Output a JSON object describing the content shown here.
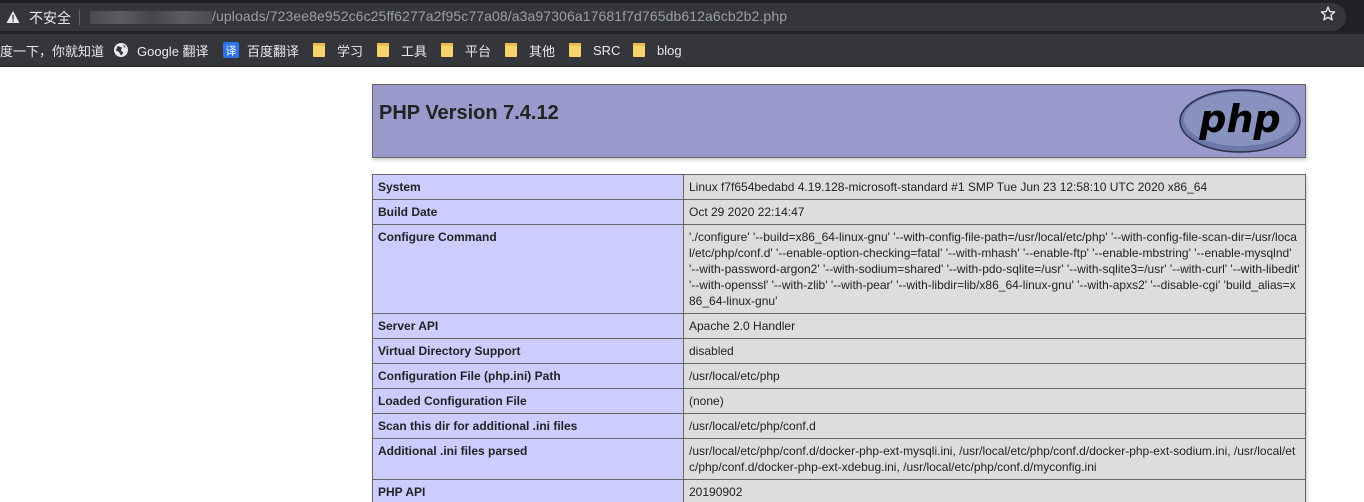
{
  "browser": {
    "security_label": "不安全",
    "url_visible": "/uploads/723ee8e952c6c25ff6277a2f95c77a08/a3a97306a17681f7d765db612a6cb2b2.php",
    "bookmarks": [
      {
        "label": "度一下，你就知道",
        "icon": "none"
      },
      {
        "label": "Google 翻译",
        "icon": "globe-icon"
      },
      {
        "label": "百度翻译",
        "icon": "translate-icon"
      },
      {
        "label": "学习",
        "icon": "folder-icon"
      },
      {
        "label": "工具",
        "icon": "folder-icon"
      },
      {
        "label": "平台",
        "icon": "folder-icon"
      },
      {
        "label": "其他",
        "icon": "folder-icon"
      },
      {
        "label": "SRC",
        "icon": "folder-icon"
      },
      {
        "label": "blog",
        "icon": "folder-icon"
      }
    ]
  },
  "php": {
    "version_title": "PHP Version 7.4.12",
    "logo_text": "php",
    "rows": [
      {
        "key": "System",
        "value": "Linux f7f654bedabd 4.19.128-microsoft-standard #1 SMP Tue Jun 23 12:58:10 UTC 2020 x86_64"
      },
      {
        "key": "Build Date",
        "value": "Oct 29 2020 22:14:47"
      },
      {
        "key": "Configure Command",
        "value": "'./configure' '--build=x86_64-linux-gnu' '--with-config-file-path=/usr/local/etc/php' '--with-config-file-scan-dir=/usr/local/etc/php/conf.d' '--enable-option-checking=fatal' '--with-mhash' '--enable-ftp' '--enable-mbstring' '--enable-mysqlnd' '--with-password-argon2' '--with-sodium=shared' '--with-pdo-sqlite=/usr' '--with-sqlite3=/usr' '--with-curl' '--with-libedit' '--with-openssl' '--with-zlib' '--with-pear' '--with-libdir=lib/x86_64-linux-gnu' '--with-apxs2' '--disable-cgi' 'build_alias=x86_64-linux-gnu'"
      },
      {
        "key": "Server API",
        "value": "Apache 2.0 Handler"
      },
      {
        "key": "Virtual Directory Support",
        "value": "disabled"
      },
      {
        "key": "Configuration File (php.ini) Path",
        "value": "/usr/local/etc/php"
      },
      {
        "key": "Loaded Configuration File",
        "value": "(none)"
      },
      {
        "key": "Scan this dir for additional .ini files",
        "value": "/usr/local/etc/php/conf.d"
      },
      {
        "key": "Additional .ini files parsed",
        "value": "/usr/local/etc/php/conf.d/docker-php-ext-mysqli.ini, /usr/local/etc/php/conf.d/docker-php-ext-sodium.ini, /usr/local/etc/php/conf.d/docker-php-ext-xdebug.ini, /usr/local/etc/php/conf.d/myconfig.ini"
      },
      {
        "key": "PHP API",
        "value": "20190902"
      }
    ]
  },
  "colors": {
    "header_bg": "#9999cc",
    "key_cell_bg": "#ccccff",
    "value_cell_bg": "#dddddd",
    "chrome_dark": "#202124",
    "chrome_bar": "#35363a"
  }
}
